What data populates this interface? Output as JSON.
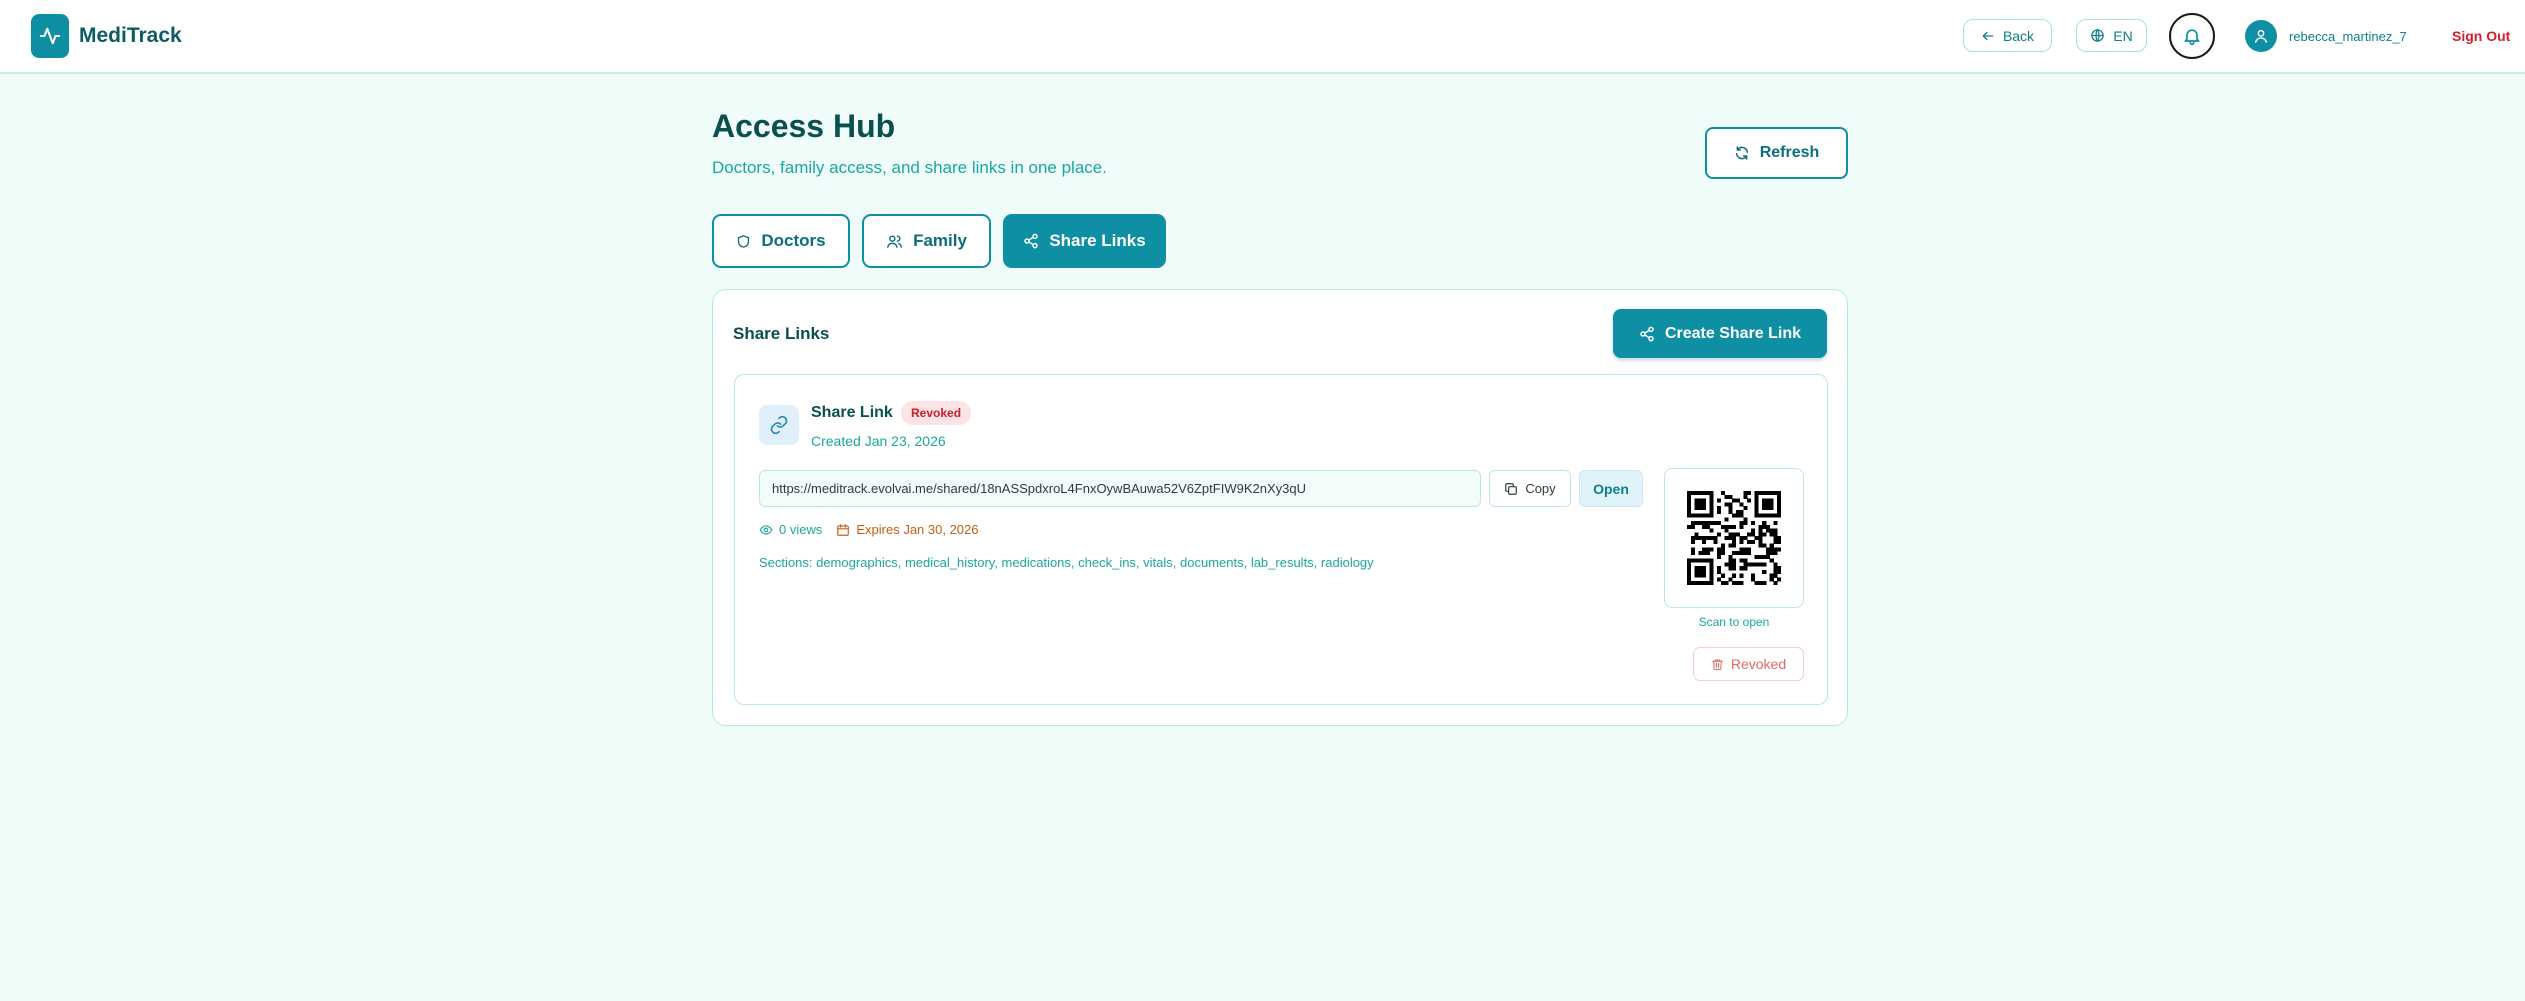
{
  "app": {
    "name": "MediTrack"
  },
  "topbar": {
    "back_label": "Back",
    "language": "EN",
    "username": "rebecca_martinez_7",
    "signout_label": "Sign Out"
  },
  "header": {
    "title": "Access Hub",
    "subtitle": "Doctors, family access, and share links in one place.",
    "refresh_label": "Refresh"
  },
  "tabs": [
    {
      "label": "Doctors",
      "active": false
    },
    {
      "label": "Family",
      "active": false
    },
    {
      "label": "Share Links",
      "active": true
    }
  ],
  "panel": {
    "title": "Share Links",
    "create_label": "Create Share Link",
    "links": [
      {
        "title": "Share Link",
        "status": "Revoked",
        "created": "Created Jan 23, 2026",
        "url": "https://meditrack.evolvai.me/shared/18nASSpdxroL4FnxOywBAuwa52V6ZptFIW9K2nXy3qU",
        "copy_label": "Copy",
        "open_label": "Open",
        "views": "0 views",
        "expires": "Expires Jan 30, 2026",
        "sections": "Sections: demographics, medical_history, medications, check_ins, vitals, documents, lab_results, radiology",
        "qr_caption": "Scan to open",
        "revoked_label": "Revoked"
      }
    ]
  },
  "colors": {
    "primary": "#0e8fa3",
    "background": "#effcfa",
    "danger": "#d61f2b",
    "warning": "#c75e12",
    "accent_text": "#1ba89e"
  }
}
